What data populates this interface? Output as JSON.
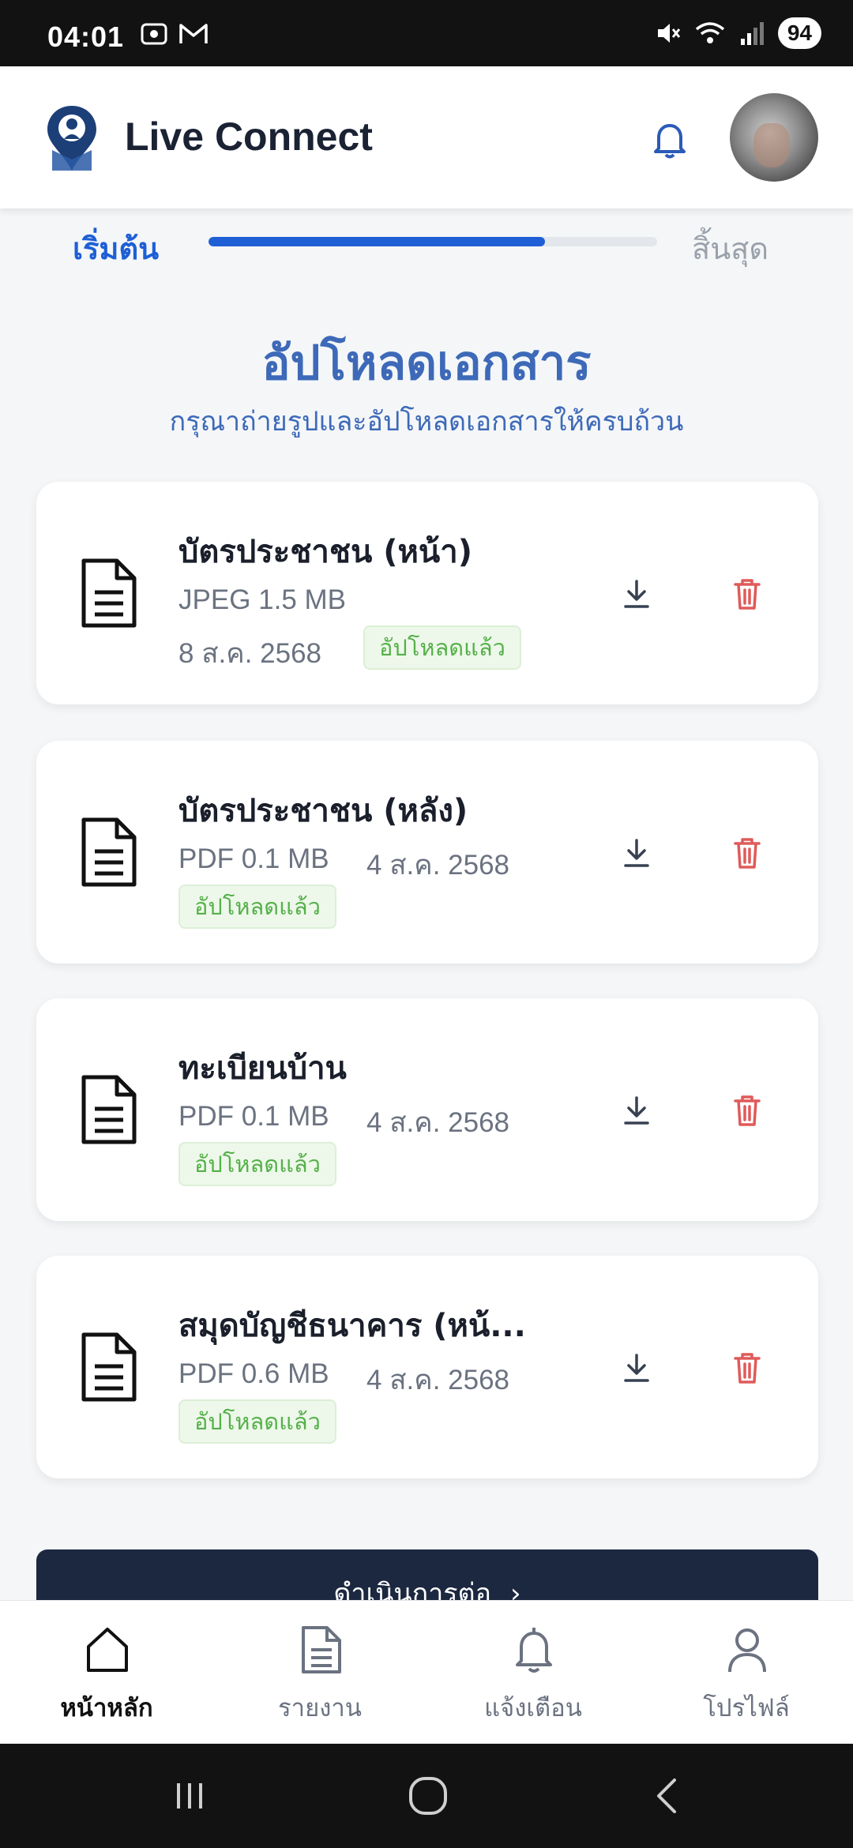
{
  "status_bar": {
    "time": "04:01",
    "battery": "94",
    "left_icons": [
      "screen-record-icon",
      "gmail-icon"
    ],
    "right_icons": [
      "mute-icon",
      "wifi-icon",
      "signal-icon"
    ]
  },
  "app_bar": {
    "title": "Live Connect",
    "logo": "live-connect-logo",
    "bell": "bell-icon",
    "avatar": "user-avatar"
  },
  "progress": {
    "start_label": "เริ่มต้น",
    "end_label": "สิ้นสุด",
    "fraction": 0.75,
    "accent": "#1e5fd6"
  },
  "heading": {
    "title": "อัปโหลดเอกสาร",
    "subtitle": "กรุณาถ่ายรูปและอัปโหลดเอกสารให้ครบถ้วน"
  },
  "documents": [
    {
      "name": "บัตรประชาชน (หน้า)",
      "meta": "JPEG 1.5 MB",
      "date": "8 ส.ค. 2568",
      "status": "อัปโหลดแล้ว"
    },
    {
      "name": "บัตรประชาชน (หลัง)",
      "meta": "PDF 0.1 MB",
      "date": "4 ส.ค. 2568",
      "status": "อัปโหลดแล้ว"
    },
    {
      "name": "ทะเบียนบ้าน",
      "meta": "PDF 0.1 MB",
      "date": "4 ส.ค. 2568",
      "status": "อัปโหลดแล้ว"
    },
    {
      "name": "สมุดบัญชีธนาคาร (หน้...",
      "meta": "PDF 0.6 MB",
      "date": "4 ส.ค. 2568",
      "status": "อัปโหลดแล้ว"
    }
  ],
  "colors": {
    "success": "#56b04a",
    "delete": "#e05a5a",
    "dark_button": "#1c2840"
  },
  "continue_button": {
    "label": "ดำเนินการต่อ",
    "icon": "chevron-right-icon"
  },
  "bottom_nav": [
    {
      "label": "หน้าหลัก",
      "icon": "home-icon",
      "active": true
    },
    {
      "label": "รายงาน",
      "icon": "report-icon",
      "active": false
    },
    {
      "label": "แจ้งเตือน",
      "icon": "bell-icon",
      "active": false
    },
    {
      "label": "โปรไฟล์",
      "icon": "profile-icon",
      "active": false
    }
  ],
  "system_nav": [
    "recents-icon",
    "home-circle-icon",
    "back-icon"
  ]
}
